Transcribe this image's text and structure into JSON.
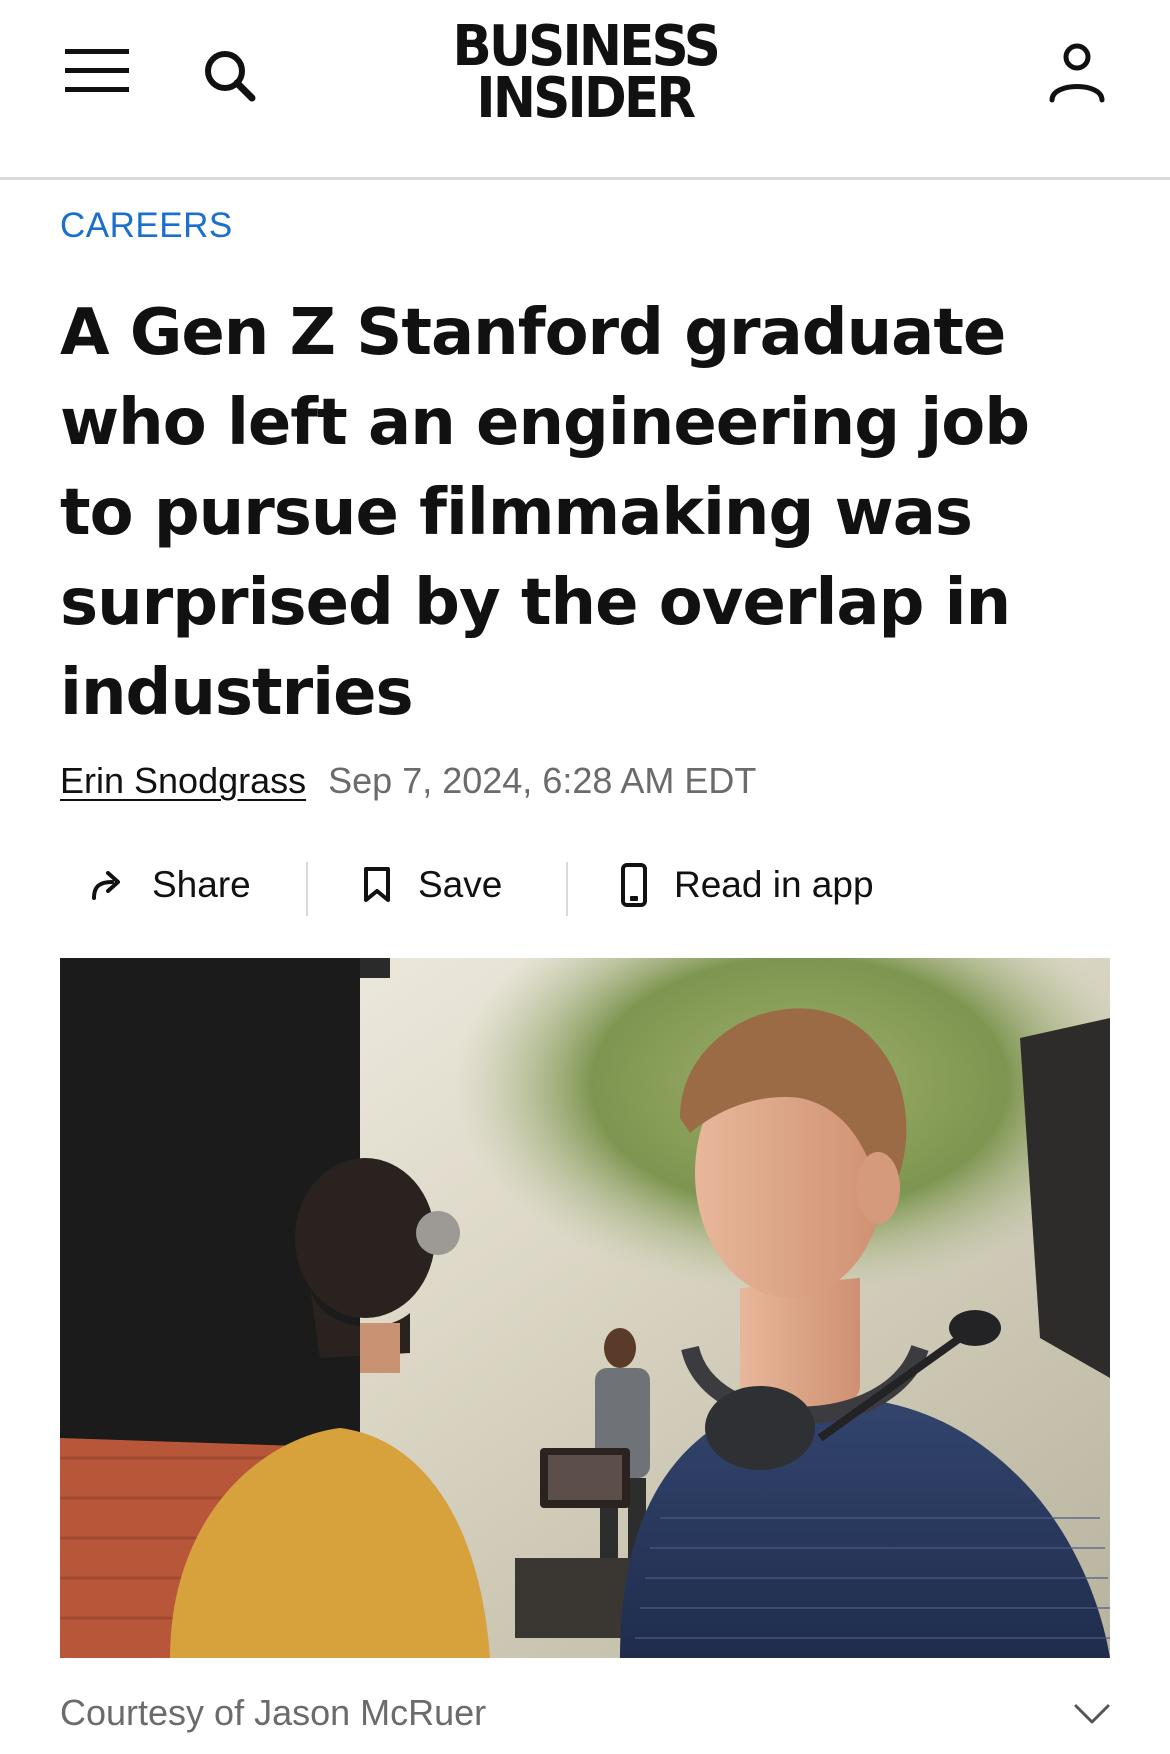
{
  "header": {
    "logo_line1": "BUSINESS",
    "logo_line2": "INSIDER",
    "icons": [
      "hamburger-menu-icon",
      "search-icon",
      "account-icon"
    ]
  },
  "article": {
    "section": "CAREERS",
    "headline": "A Gen Z Stanford graduate who left an engineering job to pursue filmmaking was surprised by the overlap in industries",
    "author": "Erin Snodgrass",
    "date": "Sep 7, 2024, 6:28 AM EDT"
  },
  "actions": {
    "share_label": "Share",
    "save_label": "Save",
    "read_in_app_label": "Read in app"
  },
  "photo": {
    "caption": "Courtesy of Jason McRuer"
  },
  "colors": {
    "section_blue": "#1b6fce",
    "text": "#111111",
    "muted": "#6b6b6b",
    "divider": "#d9d9d9"
  }
}
